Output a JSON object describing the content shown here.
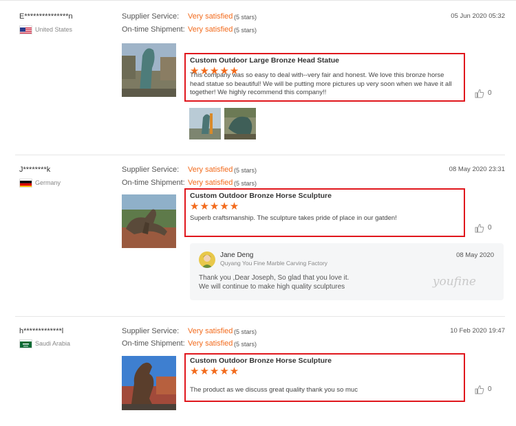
{
  "labels": {
    "supplier_service": "Supplier Service:",
    "on_time_shipment": "On-time Shipment:"
  },
  "colors": {
    "accent": "#f26b1d",
    "highlight_border": "#e0161c"
  },
  "reviews": [
    {
      "user": "E***************n",
      "country": "United States",
      "flag_icon": "us-flag-icon",
      "supplier_service": "Very satisfied",
      "supplier_service_stars": "(5 stars)",
      "on_time_shipment": "Very satisfied",
      "on_time_shipment_stars": "(5 stars)",
      "date": "05 Jun 2020 05:32",
      "product": "Custom Outdoor Large Bronze Head Statue",
      "stars": "★★★★★",
      "rating": 5,
      "comment": "This company was so easy to deal with--very fair and honest.  We love this bronze horse head statue so beautiful!  We will be putting more pictures up very soon when we have it all together!  We highly recommend this company!!",
      "likes": "0"
    },
    {
      "user": "J********k",
      "country": "Germany",
      "flag_icon": "germany-flag-icon",
      "supplier_service": "Very satisfied",
      "supplier_service_stars": "(5 stars)",
      "on_time_shipment": "Very satisfied",
      "on_time_shipment_stars": "(5 stars)",
      "date": "08 May 2020 23:31",
      "product": "Custom Outdoor Bronze Horse Sculpture",
      "stars": "★★★★★",
      "rating": 5,
      "comment": "Superb craftsmanship. The sculpture takes pride of place in our gatden!",
      "likes": "0",
      "reply": {
        "name": "Jane Deng",
        "company": "Quyang You Fine Marble Carving Factory",
        "date": "08 May 2020",
        "line1": "Thank you ,Dear Joseph, So glad that you love it.",
        "line2": "We will continue to make high quality sculptures",
        "watermark": "youfine"
      }
    },
    {
      "user": "h*************l",
      "country": "Saudi Arabia",
      "flag_icon": "saudi-flag-icon",
      "supplier_service": "Very satisfied",
      "supplier_service_stars": "(5 stars)",
      "on_time_shipment": "Very satisfied",
      "on_time_shipment_stars": "(5 stars)",
      "date": "10 Feb 2020 19:47",
      "product": "Custom Outdoor Bronze Horse Sculpture",
      "stars": "★★★★★",
      "rating": 5,
      "comment": "The product as we discuss great quality thank you so muc",
      "likes": "0"
    }
  ]
}
